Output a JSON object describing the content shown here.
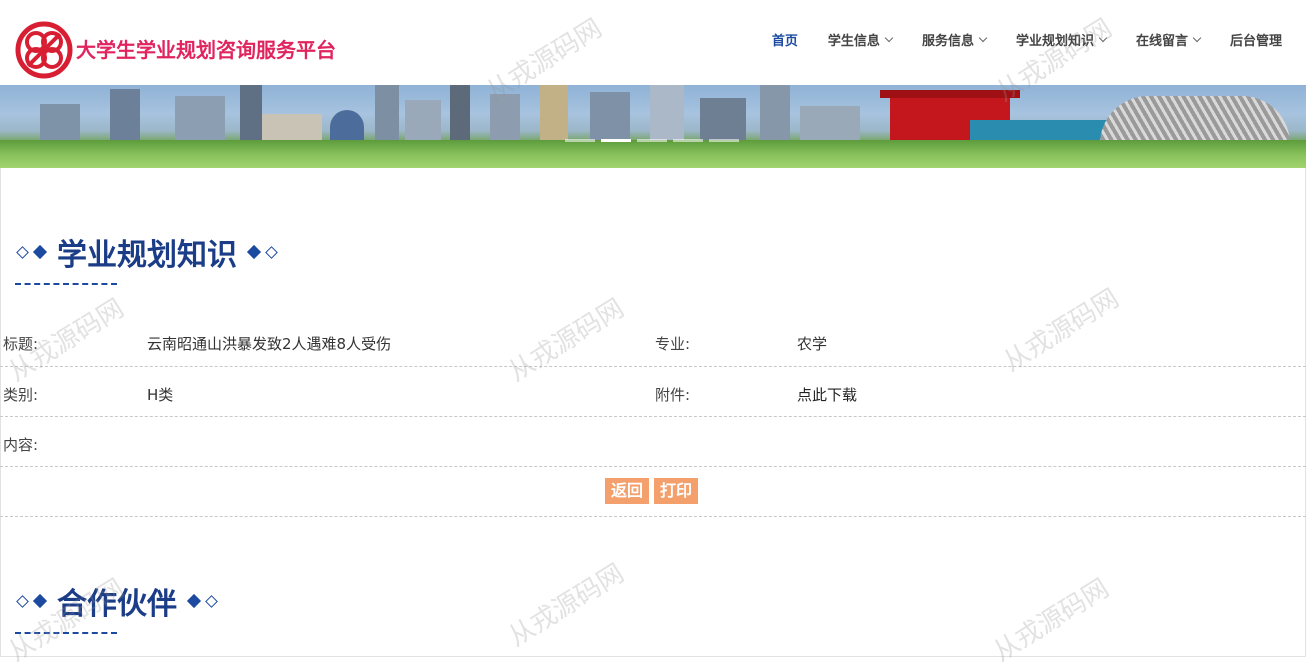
{
  "header": {
    "site_title": "大学生学业规划咨询服务平台",
    "logo_icon": "interlocking-rings-logo",
    "nav": [
      {
        "label": "首页",
        "active": true,
        "has_dropdown": false
      },
      {
        "label": "学生信息",
        "active": false,
        "has_dropdown": true
      },
      {
        "label": "服务信息",
        "active": false,
        "has_dropdown": true
      },
      {
        "label": "学业规划知识",
        "active": false,
        "has_dropdown": true
      },
      {
        "label": "在线留言",
        "active": false,
        "has_dropdown": true
      },
      {
        "label": "后台管理",
        "active": false,
        "has_dropdown": false
      }
    ]
  },
  "banner": {
    "slide_count": 5,
    "active_slide": 2
  },
  "section_knowledge": {
    "title": "学业规划知识"
  },
  "detail": {
    "title_label": "标题:",
    "title_value": "云南昭通山洪暴发致2人遇难8人受伤",
    "major_label": "专业:",
    "major_value": "农学",
    "category_label": "类别:",
    "category_value": "H类",
    "attachment_label": "附件:",
    "attachment_link": "点此下载",
    "content_label": "内容:",
    "content_value": ""
  },
  "actions": {
    "back_label": "返回",
    "print_label": "打印"
  },
  "section_partners": {
    "title": "合作伙伴"
  },
  "watermark": {
    "text": "从戎源码网"
  },
  "colors": {
    "brand_red": "#e0245e",
    "brand_blue": "#1b4aa0",
    "button_orange": "#f4a06c"
  }
}
